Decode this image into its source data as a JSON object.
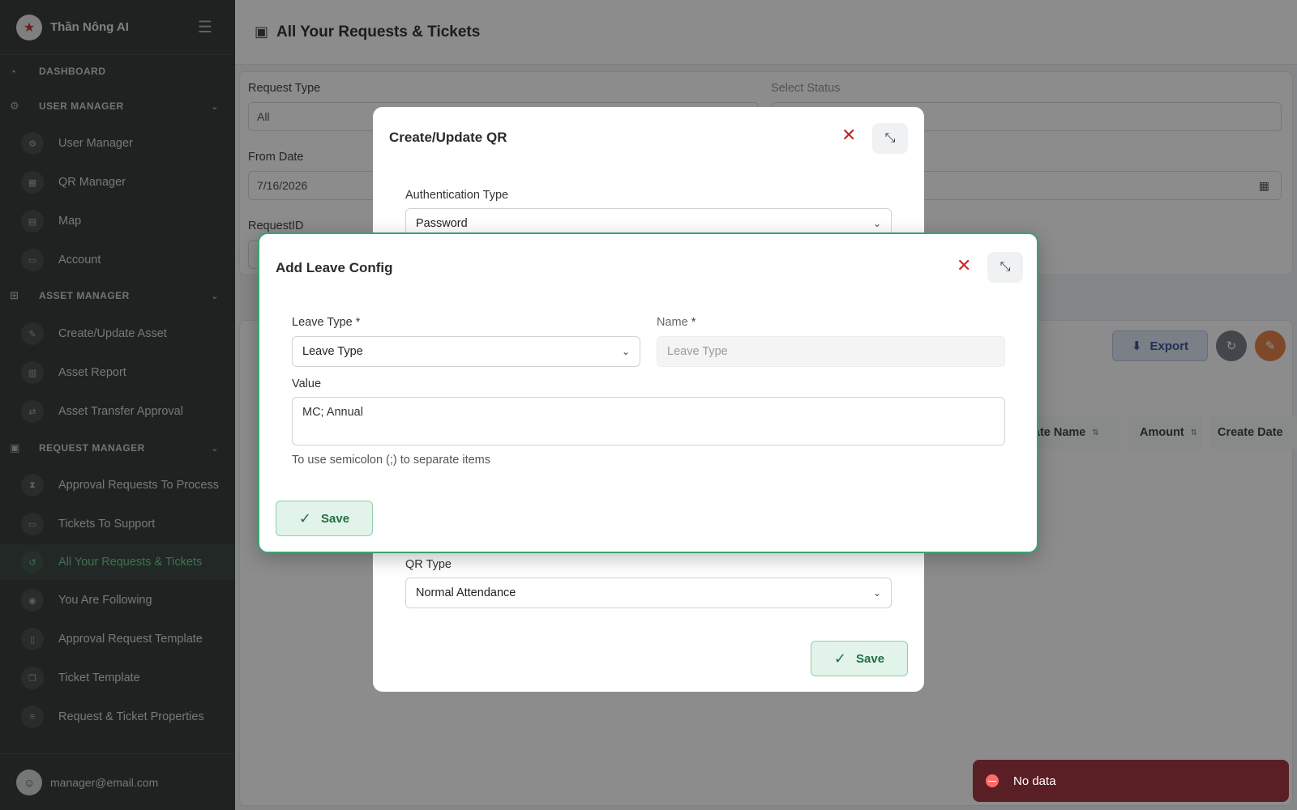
{
  "app": {
    "title": "Thần Nông AI"
  },
  "sidebar": {
    "sections": [
      {
        "label": "DASHBOARD",
        "icon": "dashboard-icon"
      },
      {
        "label": "USER MANAGER",
        "icon": "users-icon"
      },
      {
        "label": "ASSET MANAGER",
        "icon": "sitemap-icon"
      },
      {
        "label": "REQUEST MANAGER",
        "icon": "clipboard-icon"
      }
    ],
    "items": [
      {
        "label": "User Manager",
        "icon": "user-cog-icon"
      },
      {
        "label": "QR Manager",
        "icon": "qr-icon"
      },
      {
        "label": "Map",
        "icon": "map-icon"
      },
      {
        "label": "Account",
        "icon": "id-card-icon"
      },
      {
        "label": "Create/Update Asset",
        "icon": "edit-icon"
      },
      {
        "label": "Asset Report",
        "icon": "chart-icon"
      },
      {
        "label": "Asset Transfer Approval",
        "icon": "transfer-icon"
      },
      {
        "label": "Approval Requests To Process",
        "icon": "hourglass-icon"
      },
      {
        "label": "Tickets To Support",
        "icon": "ticket-icon"
      },
      {
        "label": "All Your Requests & Tickets",
        "icon": "history-icon"
      },
      {
        "label": "You Are Following",
        "icon": "eye-icon"
      },
      {
        "label": "Approval Request Template",
        "icon": "file-icon"
      },
      {
        "label": "Ticket Template",
        "icon": "copy-icon"
      },
      {
        "label": "Request & Ticket Properties",
        "icon": "list-icon"
      }
    ],
    "footer_email": "manager@email.com"
  },
  "page": {
    "title": "All Your Requests & Tickets",
    "filters": {
      "request_type_label": "Request Type",
      "request_type_value": "All",
      "select_status_label": "Select Status",
      "from_date_label": "From Date",
      "from_date_value": "7/16/2026",
      "request_id_label": "RequestID"
    },
    "export_label": "Export",
    "table_headers": [
      "plate Name",
      "Amount",
      "Create Date"
    ]
  },
  "dialog_qr": {
    "title": "Create/Update QR",
    "auth_type_label": "Authentication Type",
    "auth_type_value": "Password",
    "qr_type_label": "QR Type",
    "qr_type_value": "Normal Attendance",
    "save_label": "Save"
  },
  "dialog_leave": {
    "title": "Add Leave Config",
    "leave_type_label": "Leave Type",
    "leave_type_value": "Leave Type",
    "name_label": "Name",
    "name_placeholder": "Leave Type",
    "required_mark": "*",
    "value_label": "Value",
    "value_text": "MC; Annual",
    "hint": "To use semicolon (;) to separate items",
    "save_label": "Save"
  },
  "toast": {
    "message": "No data"
  },
  "colors": {
    "accent": "#3aa374",
    "danger": "#c62828",
    "sidebar_bg": "#3a3f3d"
  }
}
